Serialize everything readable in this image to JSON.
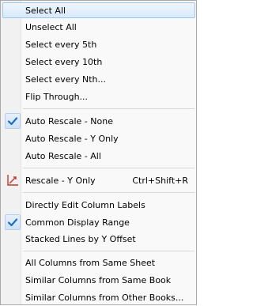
{
  "menu": {
    "items": [
      {
        "label": "Select All"
      },
      {
        "label": "Unselect All"
      },
      {
        "label": "Select every 5th"
      },
      {
        "label": "Select every 10th"
      },
      {
        "label": "Select every Nth..."
      },
      {
        "label": "Flip Through..."
      },
      {
        "label": "Auto Rescale - None"
      },
      {
        "label": "Auto Rescale - Y Only"
      },
      {
        "label": "Auto Rescale - All"
      },
      {
        "label": "Rescale - Y Only",
        "shortcut": "Ctrl+Shift+R"
      },
      {
        "label": "Directly Edit Column Labels"
      },
      {
        "label": "Common Display Range"
      },
      {
        "label": "Stacked Lines by Y Offset"
      },
      {
        "label": "All Columns from Same Sheet"
      },
      {
        "label": "Similar Columns from Same Book"
      },
      {
        "label": "Similar Columns from Other Books..."
      }
    ],
    "checked_color": "#1e6fc4",
    "rescale_icon_color": "#c0392b"
  }
}
